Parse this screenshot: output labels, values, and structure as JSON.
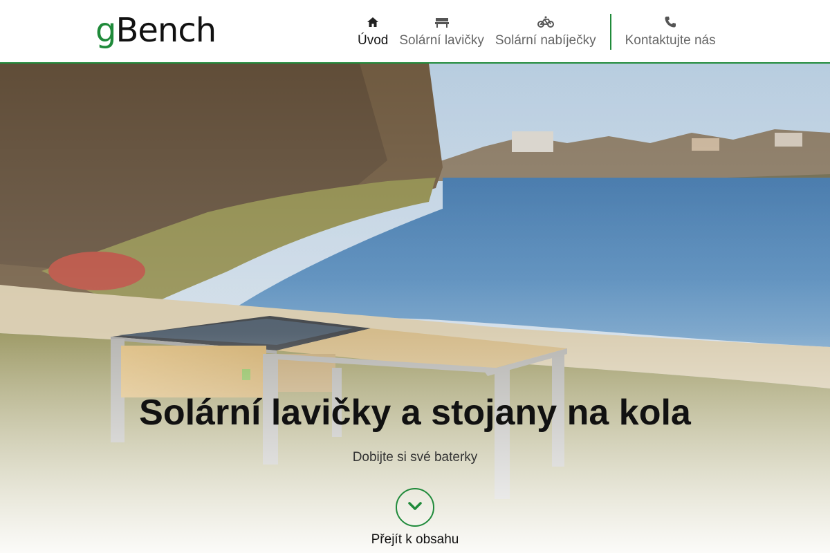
{
  "logo": {
    "prefix": "g",
    "rest": "Bench"
  },
  "nav": {
    "items": [
      {
        "label": "Úvod",
        "icon": "home-icon",
        "active": true
      },
      {
        "label": "Solární lavičky",
        "icon": "bench-icon",
        "active": false
      },
      {
        "label": "Solární nabíječky",
        "icon": "bicycle-icon",
        "active": false
      }
    ],
    "contact": {
      "label": "Kontaktujte nás",
      "icon": "phone-icon"
    }
  },
  "hero": {
    "title": "Solární lavičky a stojany na kola",
    "subtitle": "Dobijte si své baterky",
    "scroll_label": "Přejít k obsahu"
  },
  "colors": {
    "accent": "#1f8a3a",
    "text": "#111111",
    "muted": "#666666"
  }
}
